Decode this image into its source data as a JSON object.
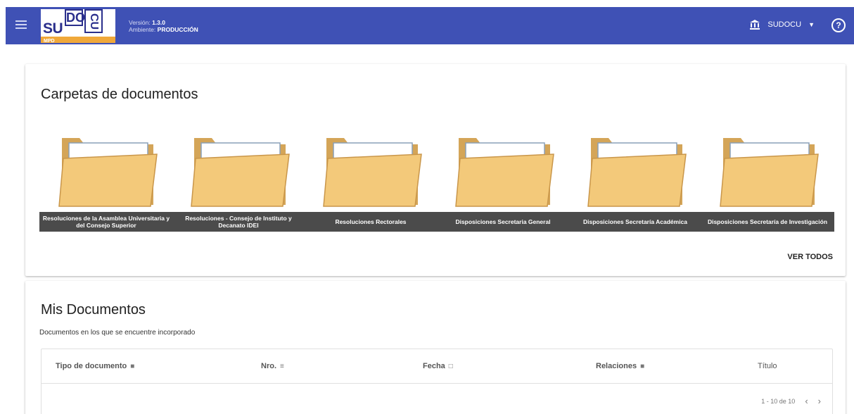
{
  "header": {
    "version_label": "Versión:",
    "version_value": "1.3.0",
    "env_label": "Ambiente:",
    "env_value": "PRODUCCIÓN",
    "user_name": "SUDOCU",
    "logo": {
      "su": "SU",
      "do": "DO",
      "cu": "CU",
      "mpd": "MPD"
    },
    "colors": {
      "bar": "#3f51b5",
      "logo_accent": "#f0a83a"
    },
    "icons": {
      "menu": "menu-icon",
      "bank": "bank-icon",
      "dropdown": "caret-down-icon",
      "help": "help-icon"
    }
  },
  "folders_card": {
    "title": "Carpetas de documentos",
    "folders": [
      {
        "label": "Resoluciones de la Asamblea Universitaria y del Consejo Superior"
      },
      {
        "label": "Resoluciones - Consejo de Instituto y Decanato IDEI"
      },
      {
        "label": "Resoluciones Rectorales"
      },
      {
        "label": "Disposiciones Secretaria General"
      },
      {
        "label": "Disposiciones Secretaría Académica"
      },
      {
        "label": "Disposiciones Secretaría de Investigación"
      }
    ],
    "view_all": "VER TODOS"
  },
  "docs_card": {
    "title": "Mis Documentos",
    "subtitle": "Documentos en los que se encuentre incorporado",
    "columns": [
      {
        "label": "Tipo de documento",
        "icon": "■"
      },
      {
        "label": "Nro.",
        "icon": "≡"
      },
      {
        "label": "Fecha",
        "icon": "□"
      },
      {
        "label": "Relaciones",
        "icon": "■"
      },
      {
        "label": "Título",
        "icon": ""
      }
    ],
    "pagination": "1 - 10 de 10"
  }
}
